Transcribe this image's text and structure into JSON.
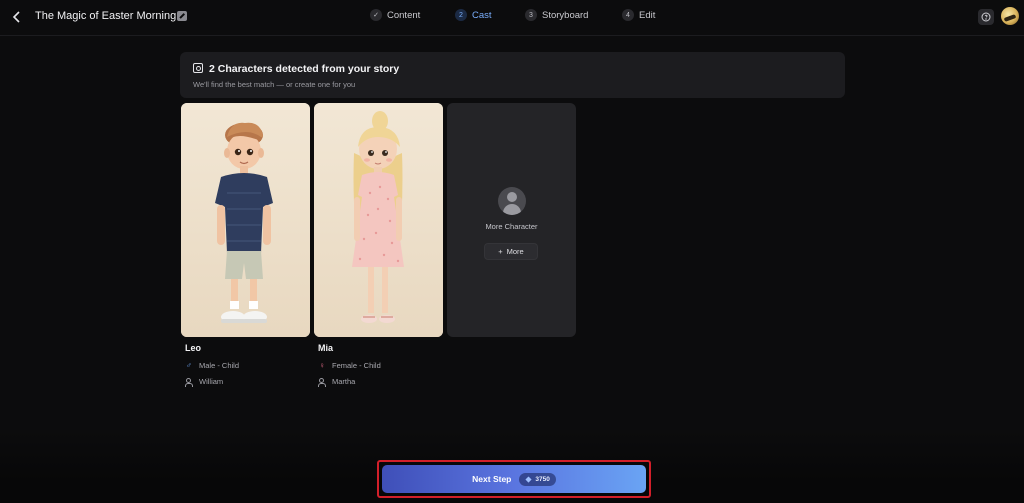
{
  "header": {
    "title": "The Magic of Easter Morning",
    "steps": [
      {
        "num": "✓",
        "label": "Content"
      },
      {
        "num": "2",
        "label": "Cast"
      },
      {
        "num": "3",
        "label": "Storyboard"
      },
      {
        "num": "4",
        "label": "Edit"
      }
    ],
    "active_step": "Cast"
  },
  "banner": {
    "title": "2 Characters detected from your story",
    "subtitle": "We'll find the best match — or create one for you"
  },
  "characters": [
    {
      "name": "Leo",
      "gender": "Male - Child",
      "voice": "William"
    },
    {
      "name": "Mia",
      "gender": "Female - Child",
      "voice": "Martha"
    }
  ],
  "more_card": {
    "label": "More Character",
    "button": "More"
  },
  "footer": {
    "next_label": "Next Step",
    "credits": "3750"
  },
  "colors": {
    "accent": "#7aaefc",
    "button_gradient_start": "#3f4fb8",
    "button_gradient_end": "#6aa4f4",
    "highlight_frame": "#d21f2a"
  }
}
